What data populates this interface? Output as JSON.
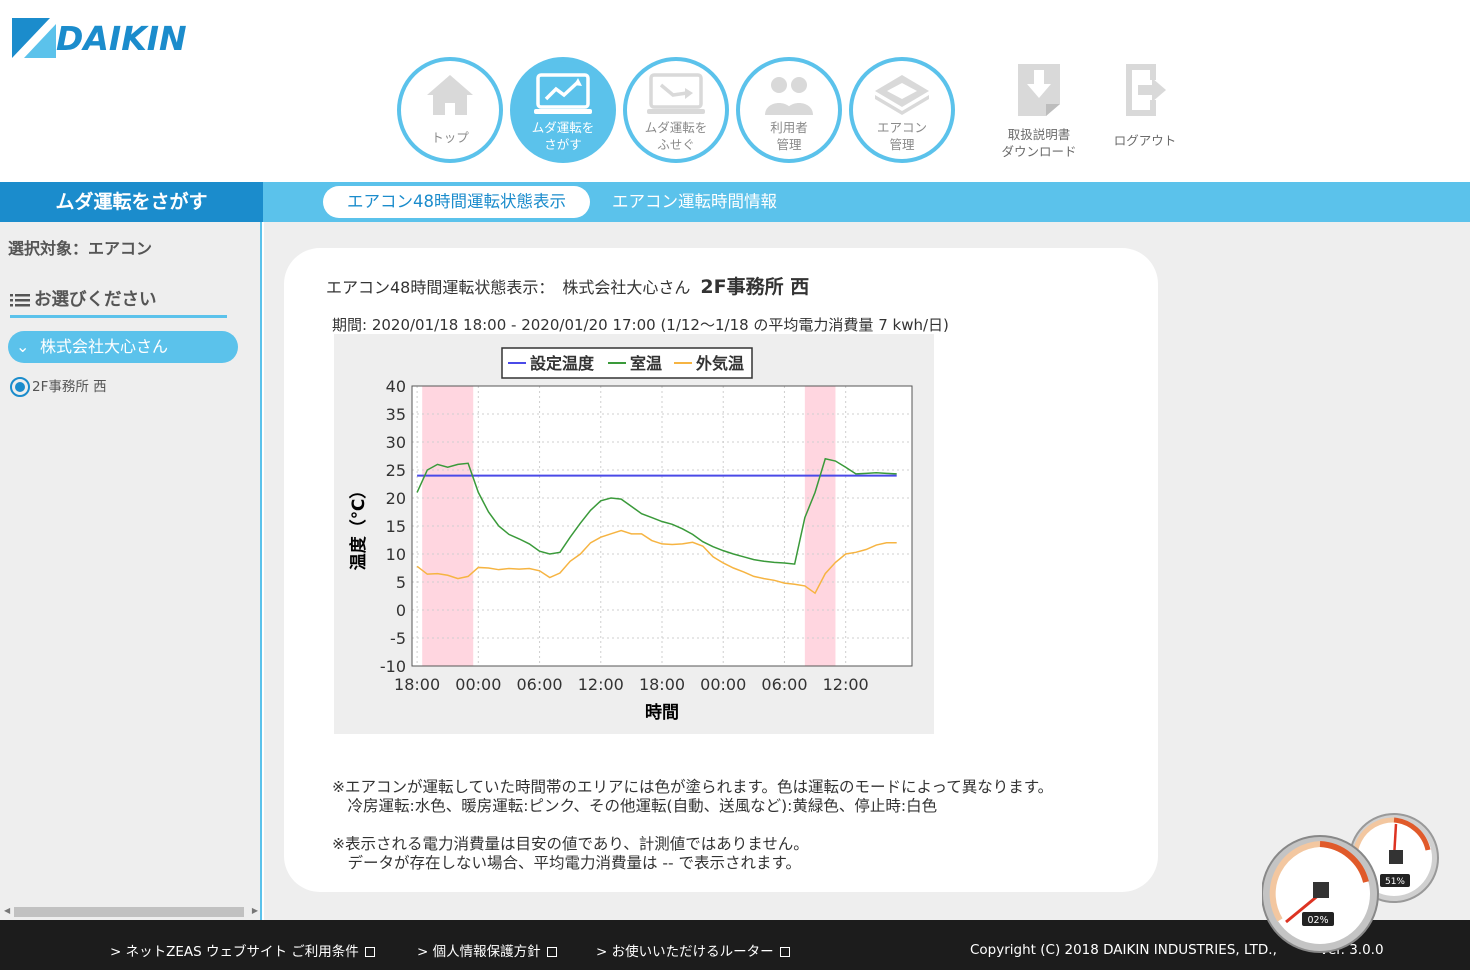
{
  "brand": {
    "logo_text": "DAIKIN"
  },
  "nav": {
    "items": [
      {
        "label": "トップ",
        "active": false
      },
      {
        "label": "ムダ運転を\nさがす",
        "active": true
      },
      {
        "label": "ムダ運転を\nふせぐ",
        "active": false
      },
      {
        "label": "利用者\n管理",
        "active": false
      },
      {
        "label": "エアコン\n管理",
        "active": false
      }
    ],
    "manual_download": "取扱説明書\nダウンロード",
    "logout": "ログアウト"
  },
  "subbar": {
    "section_title": "ムダ運転をさがす",
    "tabs": [
      {
        "label": "エアコン48時間運転状態表示",
        "active": true
      },
      {
        "label": "エアコン運転時間情報",
        "active": false
      }
    ]
  },
  "sidebar": {
    "selection_target": "選択対象：エアコン",
    "choose_heading": "お選びください",
    "company": "株式会社大心さん",
    "unit": "2F事務所 西"
  },
  "card": {
    "title_prefix": "エアコン48時間運転状態表示：　株式会社大心さん",
    "location": "2F事務所 西",
    "period": "期間: 2020/01/18 18:00 - 2020/01/20 17:00 (1/12～1/18 の平均電力消費量 7 kwh/日)",
    "notes": [
      "※エアコンが運転していた時間帯のエリアには色が塗られます。色は運転のモードによって異なります。",
      "　冷房運転:水色、暖房運転:ピンク、その他運転(自動、送風など):黄緑色、停止時:白色",
      "",
      "※表示される電力消費量は目安の値であり、計測値ではありません。",
      "　データが存在しない場合、平均電力消費量は -- で表示されます。"
    ]
  },
  "chart_data": {
    "type": "line",
    "xlabel": "時間",
    "ylabel": "温度（℃）",
    "ylim": [
      -10,
      40
    ],
    "yticks": [
      "40",
      "35",
      "30",
      "25",
      "20",
      "15",
      "10",
      "5",
      "0",
      "-5",
      "-10"
    ],
    "xticks": [
      "18:00",
      "00:00",
      "06:00",
      "12:00",
      "18:00",
      "00:00",
      "06:00",
      "12:00"
    ],
    "xticks_hours": [
      0,
      6,
      12,
      18,
      24,
      30,
      36,
      42
    ],
    "xlim_hours": [
      -0.5,
      48.5
    ],
    "grid": true,
    "legend_position": "top",
    "heating_periods_hours": [
      [
        0.5,
        5.5
      ],
      [
        38,
        41
      ]
    ],
    "heating_color": "#ffd6e0",
    "series": [
      {
        "name": "設定温度",
        "color": "#4a4ae8",
        "x": [
          0,
          47
        ],
        "y": [
          24,
          24
        ]
      },
      {
        "name": "室温",
        "color": "#3a9a3a",
        "x": [
          0,
          1,
          2,
          3,
          4,
          5,
          6,
          7,
          8,
          9,
          10,
          11,
          12,
          13,
          14,
          15,
          16,
          17,
          18,
          19,
          20,
          21,
          22,
          23,
          24,
          25,
          26,
          27,
          28,
          29,
          30,
          31,
          32,
          33,
          34,
          35,
          36,
          37,
          38,
          39,
          40,
          41,
          42,
          43,
          44,
          45,
          46,
          47
        ],
        "y": [
          21,
          25,
          26,
          25.5,
          26,
          26.2,
          21,
          17.5,
          15,
          13.5,
          12.7,
          11.8,
          10.5,
          10,
          10.3,
          13,
          15.5,
          17.8,
          19.5,
          20,
          19.8,
          18.5,
          17.2,
          16.5,
          15.8,
          15.3,
          14.5,
          13.5,
          12.2,
          11.3,
          10.6,
          10,
          9.5,
          9,
          8.7,
          8.5,
          8.4,
          8.2,
          16.5,
          21,
          27,
          26.6,
          25.5,
          24.3,
          24.4,
          24.5,
          24.4,
          24.3
        ]
      },
      {
        "name": "外気温",
        "color": "#f6b442",
        "x": [
          0,
          1,
          2,
          3,
          4,
          5,
          6,
          7,
          8,
          9,
          10,
          11,
          12,
          13,
          14,
          15,
          16,
          17,
          18,
          19,
          20,
          21,
          22,
          23,
          24,
          25,
          26,
          27,
          28,
          29,
          30,
          31,
          32,
          33,
          34,
          35,
          36,
          37,
          38,
          39,
          40,
          41,
          42,
          43,
          44,
          45,
          46,
          47
        ],
        "y": [
          7.8,
          6.4,
          6.5,
          6.2,
          5.6,
          6.0,
          7.6,
          7.5,
          7.2,
          7.4,
          7.3,
          7.4,
          7.0,
          5.8,
          6.6,
          8.7,
          10,
          12,
          13,
          13.6,
          14.2,
          13.6,
          13.6,
          12.4,
          11.8,
          11.7,
          11.8,
          12.1,
          11.4,
          9.5,
          8.4,
          7.5,
          6.8,
          6.0,
          5.6,
          5.3,
          4.8,
          4.6,
          4.3,
          3.0,
          6.5,
          8.5,
          10,
          10.3,
          10.8,
          11.6,
          12.0,
          12.0
        ]
      }
    ]
  },
  "footer": {
    "links": [
      "> ネットZEAS ウェブサイト ご利用条件",
      "> 個人情報保護方針",
      "> お使いいただけるルーター"
    ],
    "copyright": "Copyright (C) 2018 DAIKIN INDUSTRIES, LTD.,",
    "version": "ver. 3.0.0"
  },
  "widgets": {
    "gauge_small": "51%",
    "gauge_large": "02%"
  }
}
